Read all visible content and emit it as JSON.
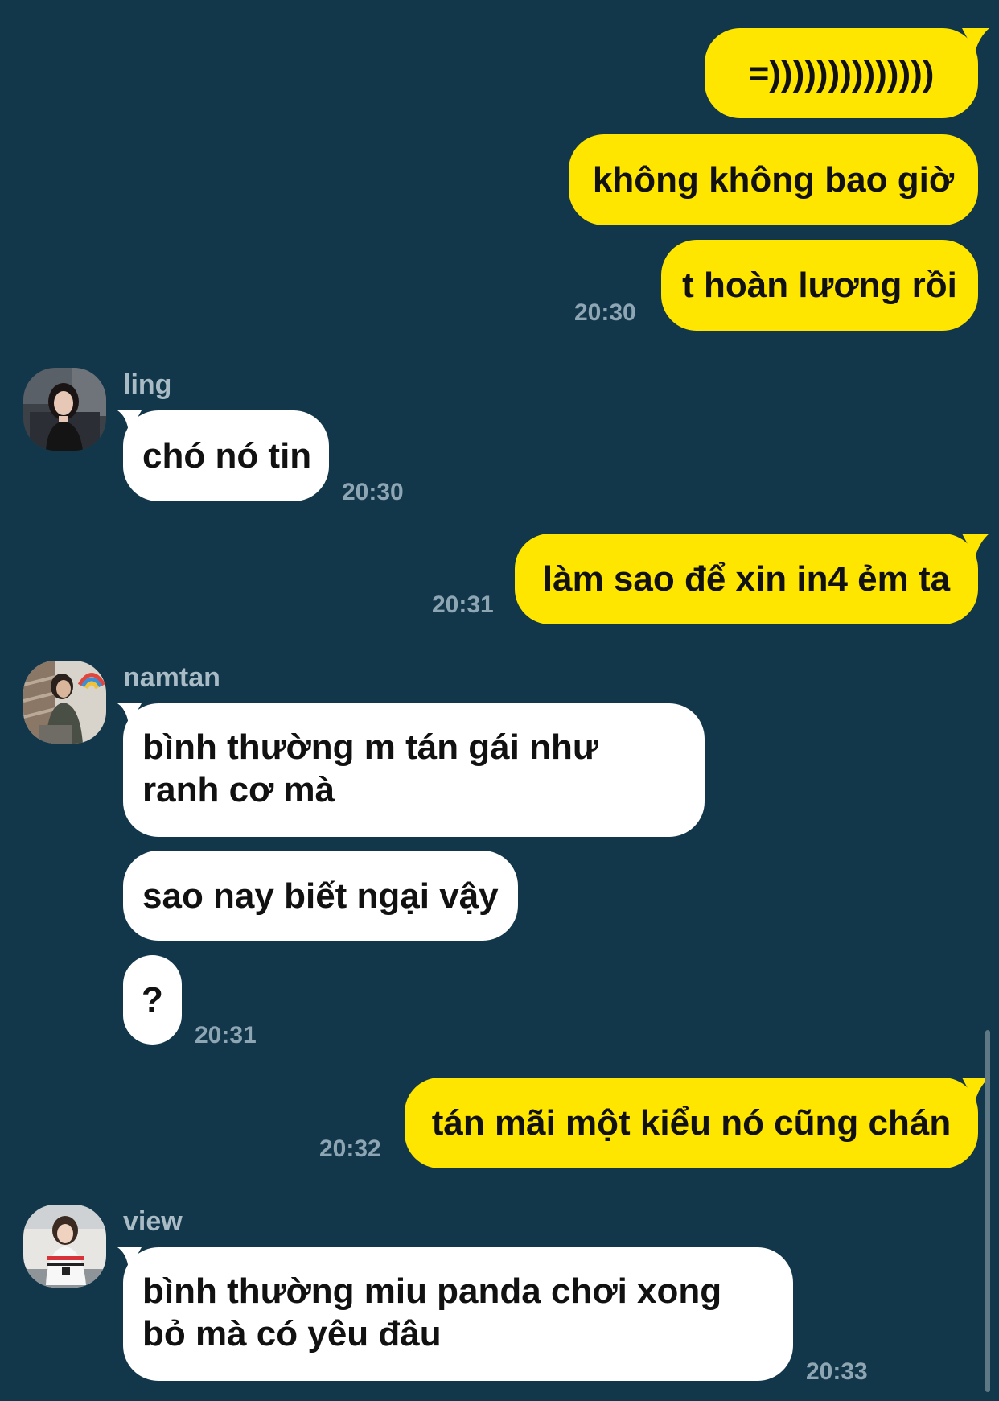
{
  "conversation": {
    "messages": [
      {
        "text": "=))))))))))))))",
        "direction": "outgoing"
      },
      {
        "text": "không không bao giờ",
        "direction": "outgoing"
      },
      {
        "text": "t hoàn lương rồi",
        "direction": "outgoing",
        "time": "20:30"
      },
      {
        "sender": "ling",
        "text": "chó nó tin",
        "direction": "incoming",
        "time": "20:30"
      },
      {
        "text": "làm sao để xin in4 ẻm ta",
        "direction": "outgoing",
        "time": "20:31"
      },
      {
        "sender": "namtan",
        "text": "bình thường m tán gái như ranh cơ mà",
        "direction": "incoming"
      },
      {
        "text": "sao nay biết ngại vậy",
        "direction": "incoming"
      },
      {
        "text": "?",
        "direction": "incoming",
        "time": "20:31"
      },
      {
        "text": "tán mãi một kiểu nó cũng chán",
        "direction": "outgoing",
        "time": "20:32"
      },
      {
        "sender": "view",
        "text": "bình thường miu panda chơi xong bỏ mà có yêu đâu",
        "direction": "incoming",
        "time": "20:33"
      }
    ]
  },
  "colors": {
    "background": "#13374a",
    "outgoing_bubble": "#ffe600",
    "incoming_bubble": "#ffffff",
    "timestamp": "#8ea6b3",
    "sender_name": "#a9bcc6"
  }
}
